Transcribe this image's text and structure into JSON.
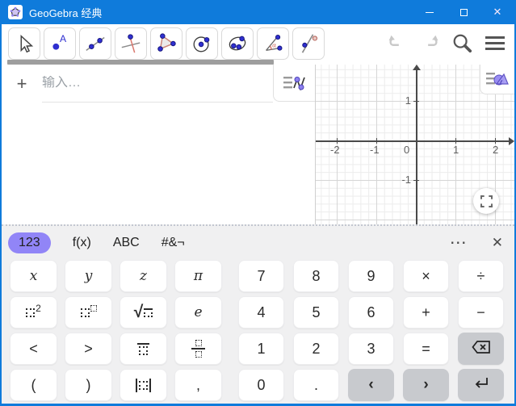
{
  "window": {
    "title": "GeoGebra 经典"
  },
  "titlebar": {
    "icons": [
      "app-logo-icon",
      "minimize-icon",
      "maximize-icon",
      "close-icon"
    ]
  },
  "toolbar": {
    "tools": [
      {
        "name": "move",
        "selected": true
      },
      {
        "name": "point",
        "selected": false
      },
      {
        "name": "line",
        "selected": false
      },
      {
        "name": "perpendicular-line",
        "selected": false
      },
      {
        "name": "polygon",
        "selected": false
      },
      {
        "name": "circle-center-point",
        "selected": false
      },
      {
        "name": "conic-through-points",
        "selected": false
      },
      {
        "name": "angle",
        "selected": false
      },
      {
        "name": "reflection",
        "selected": false
      }
    ],
    "actions": [
      "undo-icon",
      "redo-icon",
      "search-icon",
      "menu-icon"
    ]
  },
  "algebra": {
    "add_label": "+",
    "input_placeholder": "输入…"
  },
  "graphics": {
    "x_ticks": [
      {
        "v": -2,
        "label": "-2"
      },
      {
        "v": -1,
        "label": "-1"
      },
      {
        "v": 0,
        "label": "0"
      },
      {
        "v": 1,
        "label": "1"
      },
      {
        "v": 2,
        "label": "2"
      }
    ],
    "y_ticks": [
      {
        "v": 1,
        "label": "1"
      },
      {
        "v": -1,
        "label": "-1"
      }
    ],
    "icons": [
      "graphics-stylebar-icon",
      "fullscreen-icon"
    ]
  },
  "keyboard": {
    "tabs": [
      {
        "label": "123",
        "selected": true
      },
      {
        "label": "f(x)",
        "selected": false
      },
      {
        "label": "ABC",
        "selected": false
      },
      {
        "label": "#&¬",
        "selected": false
      }
    ],
    "more_icon": "⋯",
    "close_icon": "✕",
    "left_rows": [
      [
        {
          "name": "key-x",
          "label": "x",
          "italic": true
        },
        {
          "name": "key-y",
          "label": "y",
          "italic": true
        },
        {
          "name": "key-z",
          "label": "z",
          "italic": true
        },
        {
          "name": "key-pi",
          "label": "π",
          "italic": true
        }
      ],
      [
        {
          "name": "key-square",
          "glyph": "square"
        },
        {
          "name": "key-power",
          "glyph": "power"
        },
        {
          "name": "key-sqrt",
          "glyph": "sqrt"
        },
        {
          "name": "key-e",
          "label": "e",
          "italic": true
        }
      ],
      [
        {
          "name": "key-less-than",
          "label": "<"
        },
        {
          "name": "key-greater-than",
          "label": ">"
        },
        {
          "name": "key-recurring-decimal",
          "glyph": "recurring"
        },
        {
          "name": "key-fraction",
          "glyph": "fraction"
        }
      ],
      [
        {
          "name": "key-paren-open",
          "label": "("
        },
        {
          "name": "key-paren-close",
          "label": ")"
        },
        {
          "name": "key-abs",
          "glyph": "abs"
        },
        {
          "name": "key-comma",
          "label": ","
        }
      ]
    ],
    "right_rows": [
      [
        {
          "name": "key-7",
          "label": "7"
        },
        {
          "name": "key-8",
          "label": "8"
        },
        {
          "name": "key-9",
          "label": "9"
        },
        {
          "name": "key-multiply",
          "label": "×"
        },
        {
          "name": "key-divide",
          "label": "÷"
        }
      ],
      [
        {
          "name": "key-4",
          "label": "4"
        },
        {
          "name": "key-5",
          "label": "5"
        },
        {
          "name": "key-6",
          "label": "6"
        },
        {
          "name": "key-plus",
          "label": "+"
        },
        {
          "name": "key-minus",
          "label": "−"
        }
      ],
      [
        {
          "name": "key-1",
          "label": "1"
        },
        {
          "name": "key-2",
          "label": "2"
        },
        {
          "name": "key-3",
          "label": "3"
        },
        {
          "name": "key-equals",
          "label": "="
        },
        {
          "name": "key-backspace",
          "glyph": "backspace",
          "dark": true
        }
      ],
      [
        {
          "name": "key-0",
          "label": "0"
        },
        {
          "name": "key-decimal-point",
          "label": "."
        },
        {
          "name": "key-cursor-left",
          "label": "‹",
          "dark": true,
          "bold": true
        },
        {
          "name": "key-cursor-right",
          "label": "›",
          "dark": true,
          "bold": true
        },
        {
          "name": "key-enter",
          "glyph": "enter",
          "dark": true
        }
      ]
    ]
  }
}
